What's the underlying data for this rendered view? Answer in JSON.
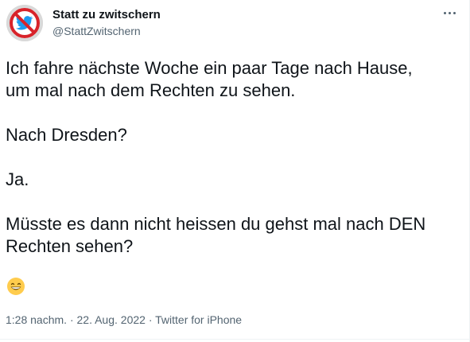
{
  "author": {
    "display_name": "Statt zu zwitschern",
    "handle": "@StattZwitschern",
    "avatar_icon": "no-bird-sign-icon"
  },
  "tweet": {
    "text": "Ich fahre nächste Woche ein paar Tage nach Hause,\num mal nach dem Rechten zu sehen.\n\nNach Dresden?\n\nJa.\n\nMüsste es dann nicht heissen du gehst mal nach DEN\nRechten sehen?",
    "emoji": "😁",
    "emoji_icon": "grinning-face-icon"
  },
  "meta": {
    "time": "1:28 nachm.",
    "separator_1": " · ",
    "date": "22. Aug. 2022",
    "separator_2": " · ",
    "source": "Twitter for iPhone"
  },
  "more_menu_icon": "more-dots-icon",
  "colors": {
    "primary_text": "#0f1419",
    "secondary_text": "#536471",
    "twitter_blue": "#1d9bf0",
    "sign_red": "#d8232a",
    "divider": "#eff3f4"
  }
}
